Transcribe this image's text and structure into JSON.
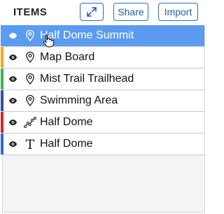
{
  "panel": {
    "title": "ITEMS",
    "share_label": "Share",
    "import_label": "Import"
  },
  "items": [
    {
      "label": "Half Dome Summit",
      "type": "marker",
      "color": "#5b9bf0",
      "selected": true
    },
    {
      "label": "Map Board",
      "type": "marker",
      "color": "#f5a623"
    },
    {
      "label": "Mist Trail Trailhead",
      "type": "marker",
      "color": "#3cb54a"
    },
    {
      "label": "Swimming Area",
      "type": "marker",
      "color": "#2f4fa8"
    },
    {
      "label": "Half Dome",
      "type": "line",
      "color": "#d0262e"
    },
    {
      "label": "Half Dome",
      "type": "text",
      "color": "#3a63d1"
    }
  ],
  "icons": {
    "expand": "expand-icon",
    "visibility": "eye-icon",
    "marker": "map-pin-icon",
    "line": "path-line-icon",
    "text": "text-icon",
    "cursor": "hand-pointer-icon"
  }
}
